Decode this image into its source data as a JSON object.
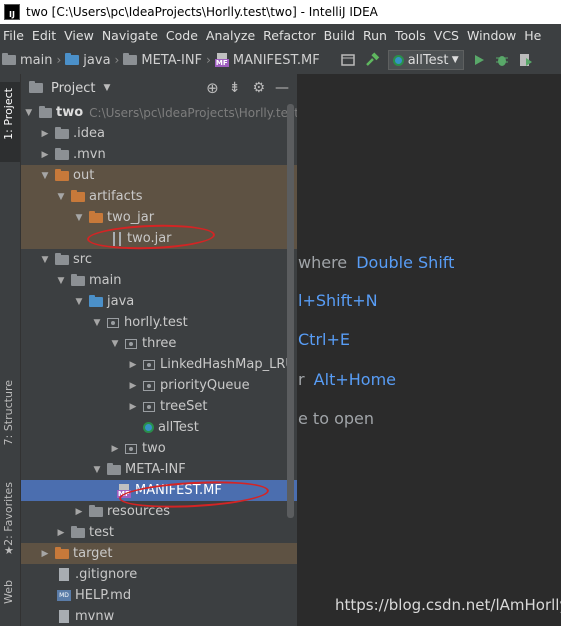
{
  "title": "two [C:\\Users\\pc\\IdeaProjects\\Horlly.test\\two] - IntelliJ IDEA",
  "app_icon_label": "IJ",
  "menu": [
    "File",
    "Edit",
    "View",
    "Navigate",
    "Code",
    "Analyze",
    "Refactor",
    "Build",
    "Run",
    "Tools",
    "VCS",
    "Window",
    "He"
  ],
  "breadcrumbs": [
    "main",
    "java",
    "META-INF",
    "MANIFEST.MF"
  ],
  "run_config": "allTest",
  "mf_tag": "MF",
  "md_tag": "MD",
  "project_panel": {
    "title": "Project"
  },
  "side_tabs": {
    "project": "1: Project",
    "structure": "7: Structure",
    "favorites": "2: Favorites",
    "web": "Web"
  },
  "tree": [
    {
      "label": "two",
      "path": "C:\\Users\\pc\\IdeaProjects\\Horlly.test"
    },
    {
      "label": ".idea"
    },
    {
      "label": ".mvn"
    },
    {
      "label": "out"
    },
    {
      "label": "artifacts"
    },
    {
      "label": "two_jar"
    },
    {
      "label": "two.jar"
    },
    {
      "label": "src"
    },
    {
      "label": "main"
    },
    {
      "label": "java"
    },
    {
      "label": "horlly.test"
    },
    {
      "label": "three"
    },
    {
      "label": "LinkedHashMap_LRU"
    },
    {
      "label": "priorityQueue"
    },
    {
      "label": "treeSet"
    },
    {
      "label": "allTest"
    },
    {
      "label": "two"
    },
    {
      "label": "META-INF"
    },
    {
      "label": "MANIFEST.MF"
    },
    {
      "label": "resources"
    },
    {
      "label": "test"
    },
    {
      "label": "target"
    },
    {
      "label": ".gitignore"
    },
    {
      "label": "HELP.md"
    },
    {
      "label": "mvnw"
    }
  ],
  "editor_hints": [
    {
      "text": "where ",
      "key": "Double Shift"
    },
    {
      "text": "",
      "key": "l+Shift+N"
    },
    {
      "text": "",
      "key": "Ctrl+E"
    },
    {
      "text": "r ",
      "key": "Alt+Home"
    },
    {
      "text": "e to open",
      "key": ""
    }
  ],
  "watermark": "https://blog.csdn.net/lAmHorlly",
  "colors": {
    "selection": "#4b6eaf",
    "accent_key": "#589df6",
    "annotation_red": "#d42424"
  }
}
